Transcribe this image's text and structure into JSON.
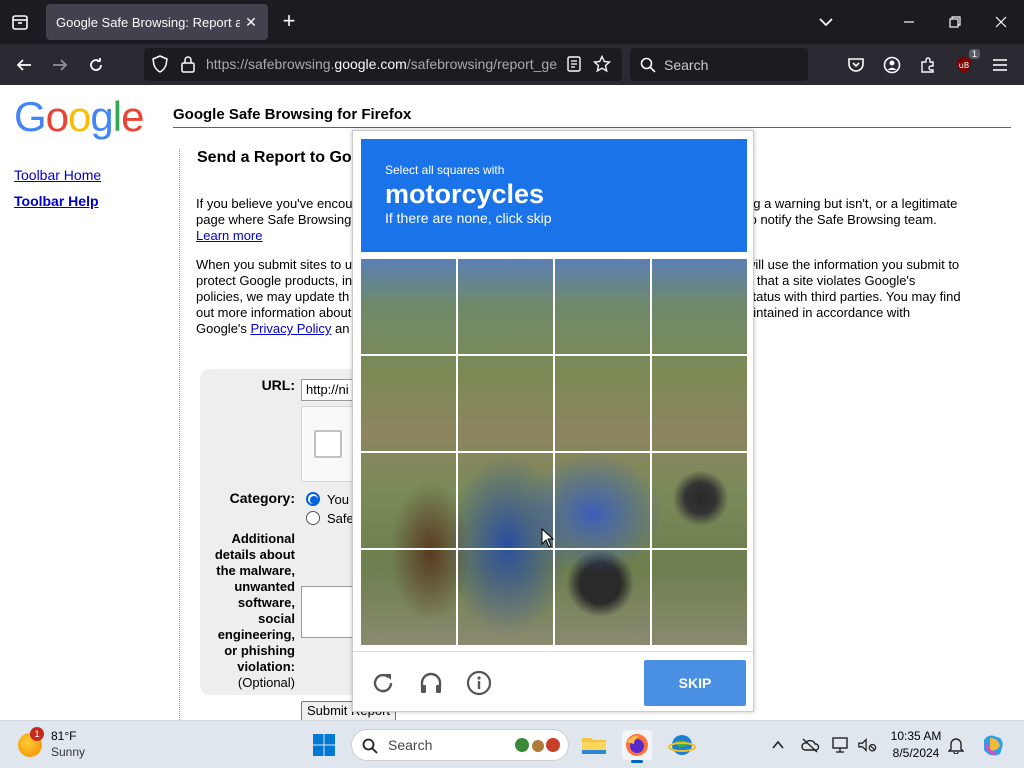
{
  "browser": {
    "tab_title": "Google Safe Browsing: Report a Phishing Page",
    "url_prefix": "https://safebrowsing.",
    "url_host": "google.com",
    "url_suffix": "/safebrowsing/report_general/",
    "search_placeholder": "Search",
    "extension_badge": "1"
  },
  "page": {
    "logo_letters": [
      "G",
      "o",
      "o",
      "g",
      "l",
      "e"
    ],
    "logo_colors": [
      "#4285f4",
      "#ea4335",
      "#fbbc05",
      "#4285f4",
      "#34a853",
      "#ea4335"
    ],
    "site_title": "Google Safe Browsing for Firefox",
    "sidebar": {
      "toolbar_home": "Toolbar Home",
      "toolbar_help": "Toolbar Help"
    },
    "heading": "Send a Report to Go",
    "para1_left": [
      "If you believe you've encour",
      "page where Safe Browsing"
    ],
    "para1_link": "Learn more",
    "para1_right": [
      "ng a warning but isn't, or a legitimate",
      "to notify the Safe Browsing team."
    ],
    "para2_left": [
      "When you submit sites to u",
      "protect Google products, in",
      "policies, we may update th",
      "out more information about"
    ],
    "para2_last_prefix": "Google's ",
    "para2_privacy_link": "Privacy Policy",
    "para2_last_suffix": " an",
    "para2_right": [
      "will use the information you submit to",
      "e that a site violates Google's",
      "status with third parties. You may find",
      "aintained in accordance with"
    ],
    "form": {
      "url_label": "URL:",
      "url_value": "http://ni",
      "category_label": "Category:",
      "category_option1": "You",
      "category_option2": "Safe",
      "details_label_lines": [
        "Additional",
        "details about",
        "the malware,",
        "unwanted",
        "software,",
        "social",
        "engineering,",
        "or phishing",
        "violation:"
      ],
      "details_optional": "(Optional)",
      "submit_label": "Submit Report"
    }
  },
  "captcha": {
    "instruction_small": "Select all squares with",
    "target_object": "motorcycles",
    "instruction_sub": "If there are none, click skip",
    "grid_rows": 4,
    "grid_cols": 4,
    "skip_label": "SKIP",
    "colors": {
      "header": "#1a73e8",
      "skip": "#4a90e2"
    }
  },
  "taskbar": {
    "weather_temp": "81°F",
    "weather_condition": "Sunny",
    "weather_badge": "1",
    "search_placeholder": "Search",
    "clock_time": "10:35 AM",
    "clock_date": "8/5/2024"
  }
}
